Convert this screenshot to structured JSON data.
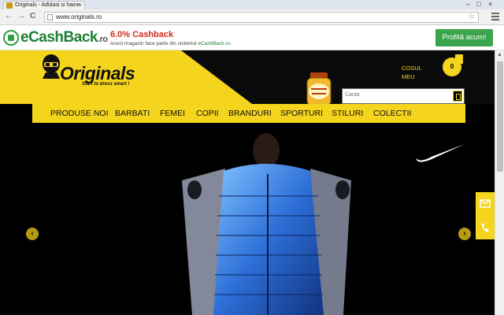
{
  "browser": {
    "tab_title": "Originals - Adidasi si haine",
    "tab_close": "×",
    "url": "www.originals.ro",
    "nav_back": "←",
    "nav_forward": "→",
    "nav_reload": "C",
    "star": "☆",
    "win_min": "–",
    "win_max": "□",
    "win_close": "×"
  },
  "ecashback": {
    "logo": "eCashBack",
    "logo_tld": ".ro",
    "rate": "6.0% Cashback",
    "desc_prefix": "Acest magazin face parte din sistemul ",
    "desc_link": "eCashBack.ro",
    "desc_suffix": ".",
    "cta": "Profită acum!"
  },
  "site": {
    "logo": "Originals",
    "logo_tagline": "Start to dress smart !",
    "search_placeholder": "Cauta",
    "cart_label_1": "COSUL",
    "cart_label_2": "MEU",
    "cart_count": "0",
    "nav": [
      "PRODUSE NOI",
      "BARBATI",
      "FEMEI",
      "COPII",
      "BRANDURI",
      "SPORTURI",
      "STILURI",
      "COLECTII"
    ],
    "slider_prev": "‹",
    "slider_next": "›"
  },
  "colors": {
    "brand_yellow": "#f4d41c",
    "ecb_green": "#3aa54a",
    "ecb_red": "#d12a1c"
  },
  "icons": [
    "favicon-icon",
    "page-icon",
    "star-icon",
    "menu-icon",
    "ecashback-logo-icon",
    "mascot-icon",
    "gift-jar-icon",
    "search-icon",
    "cart-icon",
    "nike-swoosh-icon",
    "mail-icon",
    "phone-icon"
  ]
}
